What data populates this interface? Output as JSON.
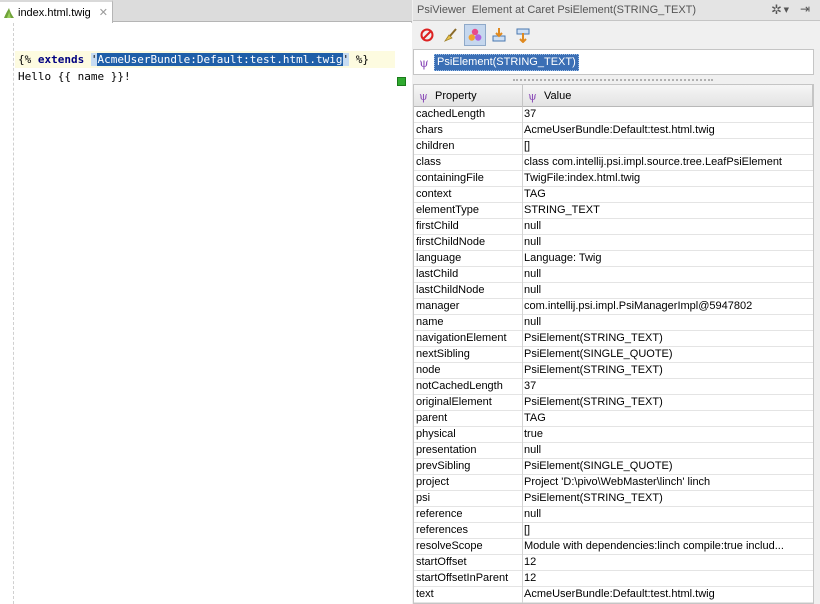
{
  "editor": {
    "tab": {
      "label": "index.html.twig",
      "close": "✕"
    },
    "lines": {
      "line1": {
        "open": "{% ",
        "keyword": "extends",
        "space": " ",
        "quote_open": "'",
        "selected": "AcmeUserBundle:Default:test.html.twig",
        "quote_close": "'",
        "close": " %}"
      },
      "line2": "Hello {{ name }}!"
    }
  },
  "psi_viewer": {
    "title": "PsiViewer",
    "subtitle": "Element at Caret PsiElement(STRING_TEXT)",
    "tree_node": "PsiElement(STRING_TEXT)",
    "table": {
      "header_property": "Property",
      "header_value": "Value",
      "rows": [
        {
          "property": "cachedLength",
          "value": "37"
        },
        {
          "property": "chars",
          "value": "AcmeUserBundle:Default:test.html.twig"
        },
        {
          "property": "children",
          "value": "[]"
        },
        {
          "property": "class",
          "value": "class com.intellij.psi.impl.source.tree.LeafPsiElement"
        },
        {
          "property": "containingFile",
          "value": "TwigFile:index.html.twig"
        },
        {
          "property": "context",
          "value": "TAG"
        },
        {
          "property": "elementType",
          "value": "STRING_TEXT"
        },
        {
          "property": "firstChild",
          "value": "null"
        },
        {
          "property": "firstChildNode",
          "value": "null"
        },
        {
          "property": "language",
          "value": "Language: Twig"
        },
        {
          "property": "lastChild",
          "value": "null"
        },
        {
          "property": "lastChildNode",
          "value": "null"
        },
        {
          "property": "manager",
          "value": "com.intellij.psi.impl.PsiManagerImpl@5947802"
        },
        {
          "property": "name",
          "value": "null"
        },
        {
          "property": "navigationElement",
          "value": "PsiElement(STRING_TEXT)"
        },
        {
          "property": "nextSibling",
          "value": "PsiElement(SINGLE_QUOTE)"
        },
        {
          "property": "node",
          "value": "PsiElement(STRING_TEXT)"
        },
        {
          "property": "notCachedLength",
          "value": "37"
        },
        {
          "property": "originalElement",
          "value": "PsiElement(STRING_TEXT)"
        },
        {
          "property": "parent",
          "value": "TAG"
        },
        {
          "property": "physical",
          "value": "true"
        },
        {
          "property": "presentation",
          "value": "null"
        },
        {
          "property": "prevSibling",
          "value": "PsiElement(SINGLE_QUOTE)"
        },
        {
          "property": "project",
          "value": "Project 'D:\\pivo\\WebMaster\\linch' linch"
        },
        {
          "property": "psi",
          "value": "PsiElement(STRING_TEXT)"
        },
        {
          "property": "reference",
          "value": "null"
        },
        {
          "property": "references",
          "value": "[]"
        },
        {
          "property": "resolveScope",
          "value": "Module with dependencies:linch compile:true includ..."
        },
        {
          "property": "startOffset",
          "value": "12"
        },
        {
          "property": "startOffsetInParent",
          "value": "12"
        },
        {
          "property": "text",
          "value": "AcmeUserBundle:Default:test.html.twig"
        }
      ]
    }
  },
  "icons": {
    "twig": "twig-file-icon",
    "gear": "gear-icon",
    "hide": "hide-panel-icon",
    "toolbar": [
      "stop-icon",
      "highlight-broom-icon",
      "properties-toggle-icon",
      "scroll-from-source-icon",
      "scroll-to-source-icon"
    ],
    "psi": "psi-element-icon"
  },
  "colors": {
    "selection": "#1f5fa8",
    "tree_selection": "#3b6fb5",
    "line_highlight": "#fdfbe0",
    "keyword": "#000080",
    "marker_ok": "#2faa2f"
  }
}
